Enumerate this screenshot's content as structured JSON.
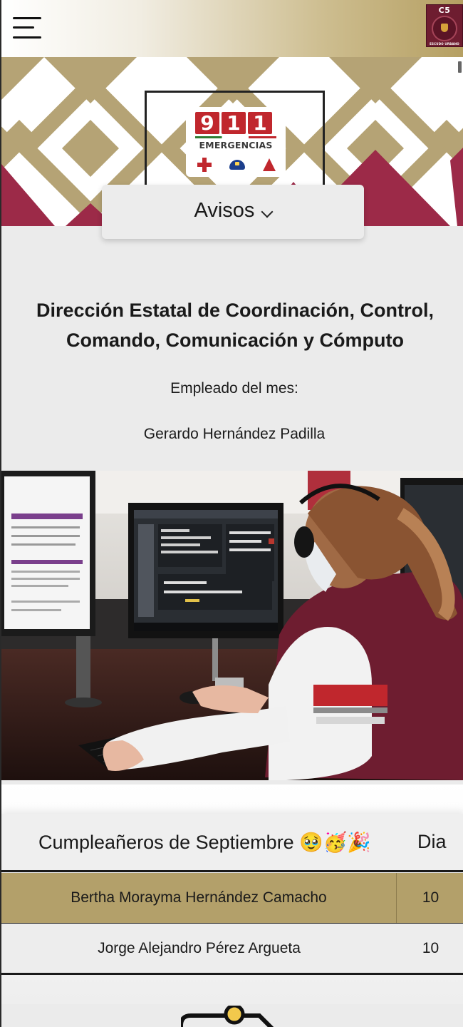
{
  "header": {
    "menu_icon": "hamburger-menu-icon",
    "logo": {
      "title": "C5",
      "caption": "ESCUDO URBANO"
    }
  },
  "hero": {
    "logo_911": {
      "digits": [
        "9",
        "1",
        "1"
      ],
      "text": "EMERGENCIAS"
    },
    "pattern_colors": {
      "gold": "#b5a375",
      "wine": "#9c2a48",
      "white": "#ffffff"
    }
  },
  "avisos": {
    "label": "Avisos",
    "icon": "chevron-down-icon"
  },
  "info": {
    "org_title": "Dirección Estatal de Coordinación, Control, Comando, Comunicación y Cómputo",
    "employee_label": "Empleado del mes:",
    "employee_name": "Gerardo Hernández Padilla"
  },
  "birthdays": {
    "header_name": "Cumpleañeros de Septiembre 🥹🥳🎉",
    "header_day": "Dia",
    "rows": [
      {
        "name": "Bertha Morayma Hernández Camacho",
        "day": "10"
      },
      {
        "name": "Jorge Alejandro Pérez Argueta",
        "day": "10"
      }
    ]
  },
  "colors": {
    "gold_accent": "#b3a06a",
    "wine": "#6e1d30",
    "red_911": "#c0272d"
  }
}
